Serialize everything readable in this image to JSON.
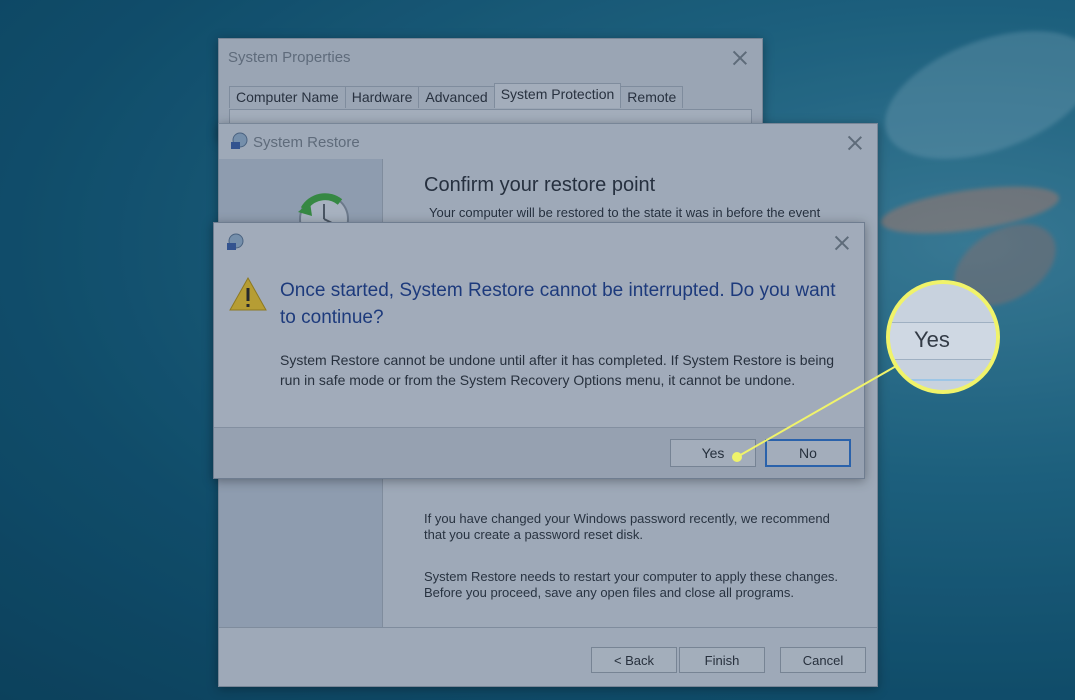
{
  "system_properties": {
    "title": "System Properties",
    "tabs": [
      {
        "label": "Computer Name"
      },
      {
        "label": "Hardware"
      },
      {
        "label": "Advanced"
      },
      {
        "label": "System Protection"
      },
      {
        "label": "Remote"
      }
    ],
    "active_tab": "System Protection"
  },
  "system_restore": {
    "title": "System Restore",
    "heading": "Confirm your restore point",
    "subtitle": "Your computer will be restored to the state it was in before the event",
    "note_password_1": "If you have changed your Windows password recently, we recommend",
    "note_password_2": "that you create a password reset disk.",
    "note_restart_1": "System Restore needs to restart your computer to apply these changes.",
    "note_restart_2": "Before you proceed, save any open files and close all programs.",
    "back_label": "< Back",
    "finish_label": "Finish",
    "cancel_label": "Cancel"
  },
  "confirm_dialog": {
    "heading": "Once started, System Restore cannot be interrupted. Do you want to continue?",
    "body": "System Restore cannot be undone until after it has completed. If System Restore is being run in safe mode or from the System Recovery Options menu, it cannot be undone.",
    "yes_label": "Yes",
    "no_label": "No"
  },
  "callout": {
    "zoom_label": "Yes",
    "highlight_color": "#f0f36a"
  },
  "icons": [
    "close-icon",
    "system-restore-icon",
    "warning-icon",
    "restore-clock-icon"
  ]
}
